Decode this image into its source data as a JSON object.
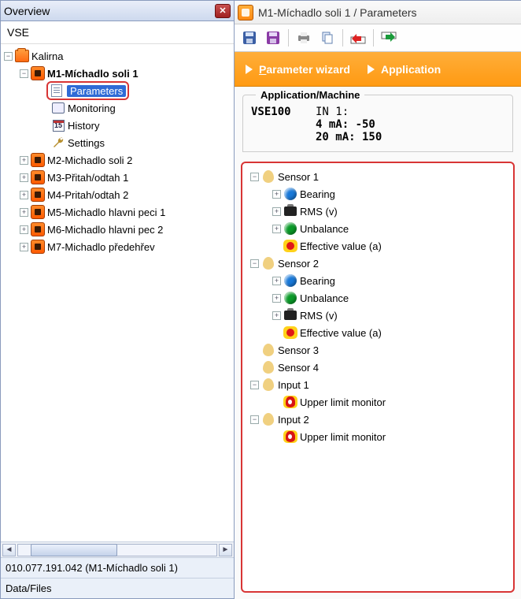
{
  "left": {
    "title": "Overview",
    "vse_label": "VSE",
    "tree": {
      "root": "Kalirna",
      "m1": "M1-Míchadlo soli 1",
      "m1_children": {
        "parameters": "Parameters",
        "monitoring": "Monitoring",
        "history": "History",
        "history_badge": "15",
        "settings": "Settings"
      },
      "others": [
        "M2-Michadlo soli 2",
        "M3-Přitah/odtah 1",
        "M4-Pritah/odtah 2",
        "M5-Michadlo hlavni peci 1",
        "M6-Michadlo hlavni pec 2",
        "M7-Michadlo předehřev"
      ]
    },
    "status1": "010.077.191.042 (M1-Míchadlo soli 1)",
    "status2": "Data/Files"
  },
  "right": {
    "title": "M1-Míchadlo soli 1 / Parameters",
    "orangebar": {
      "wizard_prefix": "P",
      "wizard_rest": "arameter wizard",
      "app": "Application"
    },
    "app_header": "Application/Machine",
    "app_model": "VSE100",
    "app_in": "IN 1:",
    "app_line1": "4 mA: -50",
    "app_line2": "20 mA: 150",
    "sensor_tree": [
      {
        "label": "Sensor 1",
        "exp": "-",
        "icon": "flame",
        "children": [
          {
            "label": "Bearing",
            "exp": "+",
            "icon": "blue"
          },
          {
            "label": "RMS (v)",
            "exp": "+",
            "icon": "rms"
          },
          {
            "label": "Unbalance",
            "exp": "+",
            "icon": "green"
          },
          {
            "label": "Effective value (a)",
            "exp": "",
            "icon": "yellowdot"
          }
        ]
      },
      {
        "label": "Sensor 2",
        "exp": "-",
        "icon": "flame",
        "children": [
          {
            "label": "Bearing",
            "exp": "+",
            "icon": "blue"
          },
          {
            "label": "Unbalance",
            "exp": "+",
            "icon": "green"
          },
          {
            "label": "RMS (v)",
            "exp": "+",
            "icon": "rms"
          },
          {
            "label": "Effective value (a)",
            "exp": "",
            "icon": "yellowdot"
          }
        ]
      },
      {
        "label": "Sensor 3",
        "exp": "",
        "icon": "flame"
      },
      {
        "label": "Sensor 4",
        "exp": "",
        "icon": "flame"
      },
      {
        "label": "Input 1",
        "exp": "-",
        "icon": "flame",
        "children": [
          {
            "label": "Upper limit monitor",
            "exp": "",
            "icon": "flamered-y"
          }
        ]
      },
      {
        "label": "Input 2",
        "exp": "-",
        "icon": "flame",
        "children": [
          {
            "label": "Upper limit monitor",
            "exp": "",
            "icon": "flamered-y"
          }
        ]
      }
    ]
  }
}
